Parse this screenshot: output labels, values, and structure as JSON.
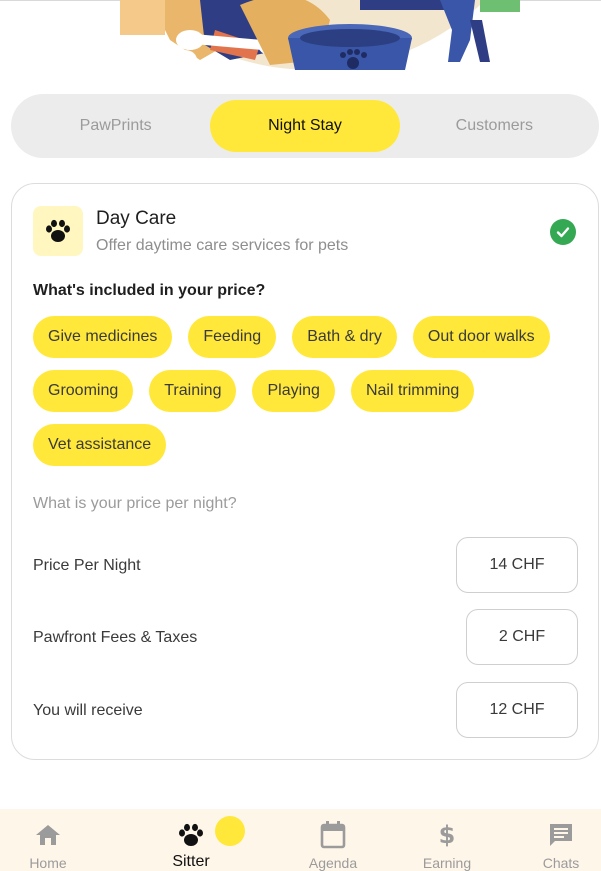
{
  "tabs": [
    {
      "label": "PawPrints",
      "active": false
    },
    {
      "label": "Night Stay",
      "active": true
    },
    {
      "label": "Customers",
      "active": false
    }
  ],
  "service": {
    "title": "Day Care",
    "subtitle": "Offer daytime care services for pets",
    "icon": "paw-icon",
    "selected_icon": "check-circle-icon"
  },
  "included": {
    "question": "What's included in your price?",
    "chips": [
      "Give medicines",
      "Feeding",
      "Bath & dry",
      "Out door walks",
      "Grooming",
      "Training",
      "Playing",
      "Nail trimming",
      "Vet assistance"
    ]
  },
  "pricing": {
    "question": "What is your price per night?",
    "rows": [
      {
        "label": "Price Per Night",
        "value": "14 CHF"
      },
      {
        "label": "Pawfront Fees & Taxes",
        "value": "2 CHF"
      },
      {
        "label": "You will receive",
        "value": "12 CHF"
      }
    ]
  },
  "nav": [
    {
      "label": "Home",
      "icon": "home-icon",
      "active": false
    },
    {
      "label": "Sitter",
      "icon": "paw-icon",
      "active": true
    },
    {
      "label": "Agenda",
      "icon": "calendar-icon",
      "active": false
    },
    {
      "label": "Earning",
      "icon": "dollar-icon",
      "active": false
    },
    {
      "label": "Chats",
      "icon": "chat-icon",
      "active": false
    }
  ],
  "colors": {
    "accent": "#ffe83a",
    "success": "#34a853",
    "nav_background": "#fff6ea"
  }
}
